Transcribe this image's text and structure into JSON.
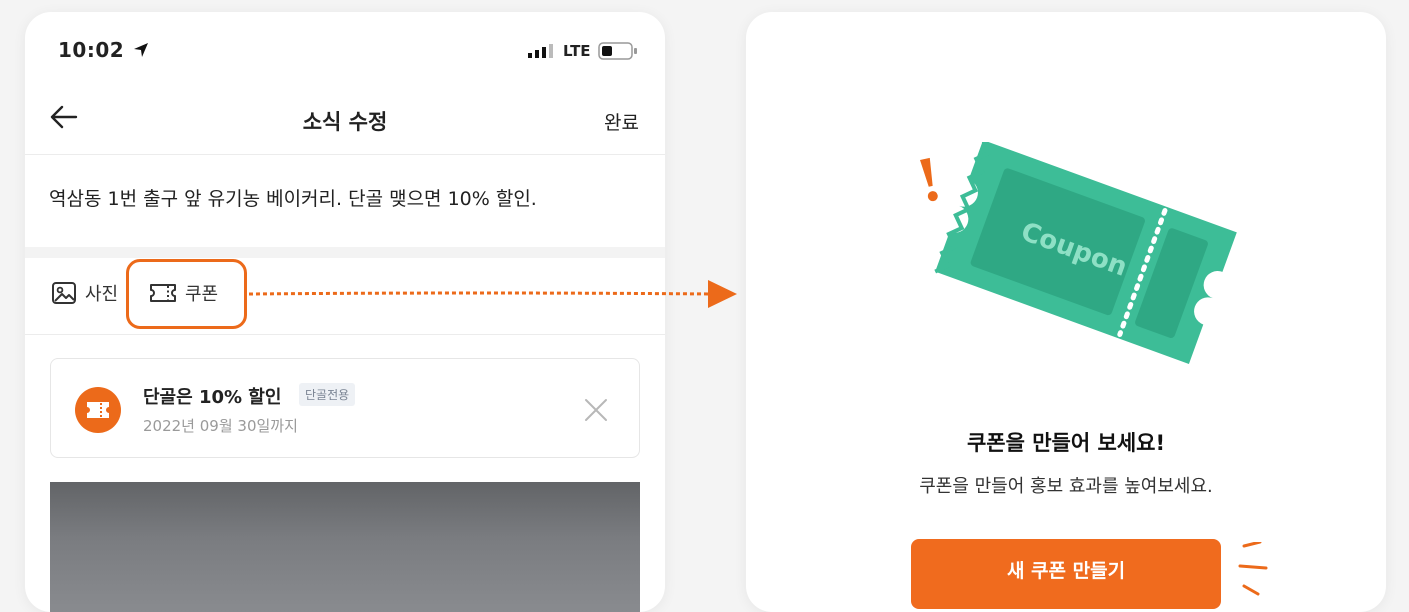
{
  "status_bar": {
    "time": "10:02",
    "network": "LTE"
  },
  "header": {
    "title": "소식 수정",
    "done_label": "완료"
  },
  "post": {
    "text": "역삼동 1번 출구 앞 유기농 베이커리. 단골 맺으면 10% 할인."
  },
  "toolbar": {
    "photo_label": "사진",
    "coupon_label": "쿠폰"
  },
  "coupon": {
    "title": "단골은 10% 할인",
    "tag": "단골전용",
    "expiry": "2022년 09월 30일까지"
  },
  "empty_state": {
    "illustration_text": "Coupon",
    "title": "쿠폰을 만들어 보세요!",
    "description": "쿠폰을 만들어 홍보 효과를 높여보세요.",
    "button_label": "새 쿠폰 만들기"
  },
  "colors": {
    "accent": "#f06b1e",
    "coupon_green": "#3dbd97",
    "coupon_green_dark": "#2fa884"
  }
}
